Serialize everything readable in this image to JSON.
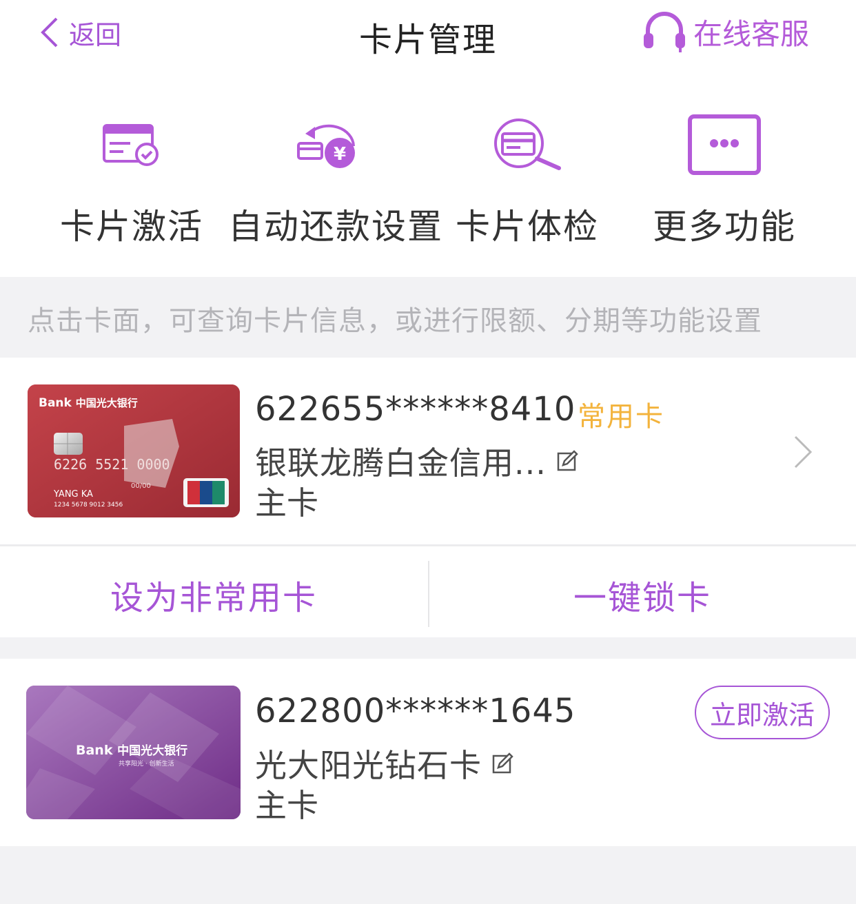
{
  "nav": {
    "back_label": "返回",
    "title": "卡片管理",
    "service_label": "在线客服"
  },
  "shortcuts": [
    {
      "label": "卡片激活",
      "icon": "card-activate-icon"
    },
    {
      "label": "自动还款设置",
      "icon": "auto-repay-icon"
    },
    {
      "label": "卡片体检",
      "icon": "card-check-icon"
    },
    {
      "label": "更多功能",
      "icon": "more-functions-icon"
    }
  ],
  "hint": "点击卡面，可查询卡片信息，或进行限额、分期等功能设置",
  "cards": [
    {
      "number": "622655******8410",
      "tag": "常用卡",
      "name": "银联龙腾白金信用...",
      "type": "主卡",
      "face": {
        "brand": "Bank",
        "bank": "中国光大银行",
        "card_no": "6226 5521 0000",
        "holder": "YANG KA",
        "expiry": "00/00",
        "small_no": "1234 5678 9012 3456",
        "unionpay": "UnionPay 银联"
      },
      "actions": [
        "设为非常用卡",
        "一键锁卡"
      ]
    },
    {
      "number": "622800******1645",
      "name": "光大阳光钻石卡",
      "type": "主卡",
      "activate_label": "立即激活",
      "face": {
        "brand": "Bank",
        "bank": "中国光大银行",
        "slogan": "共享阳光 · 创新生活"
      }
    }
  ],
  "colors": {
    "accent": "#a655d6",
    "tag": "#f3b33c",
    "card1": "#b5363e",
    "card2": "#8a4aa0"
  }
}
